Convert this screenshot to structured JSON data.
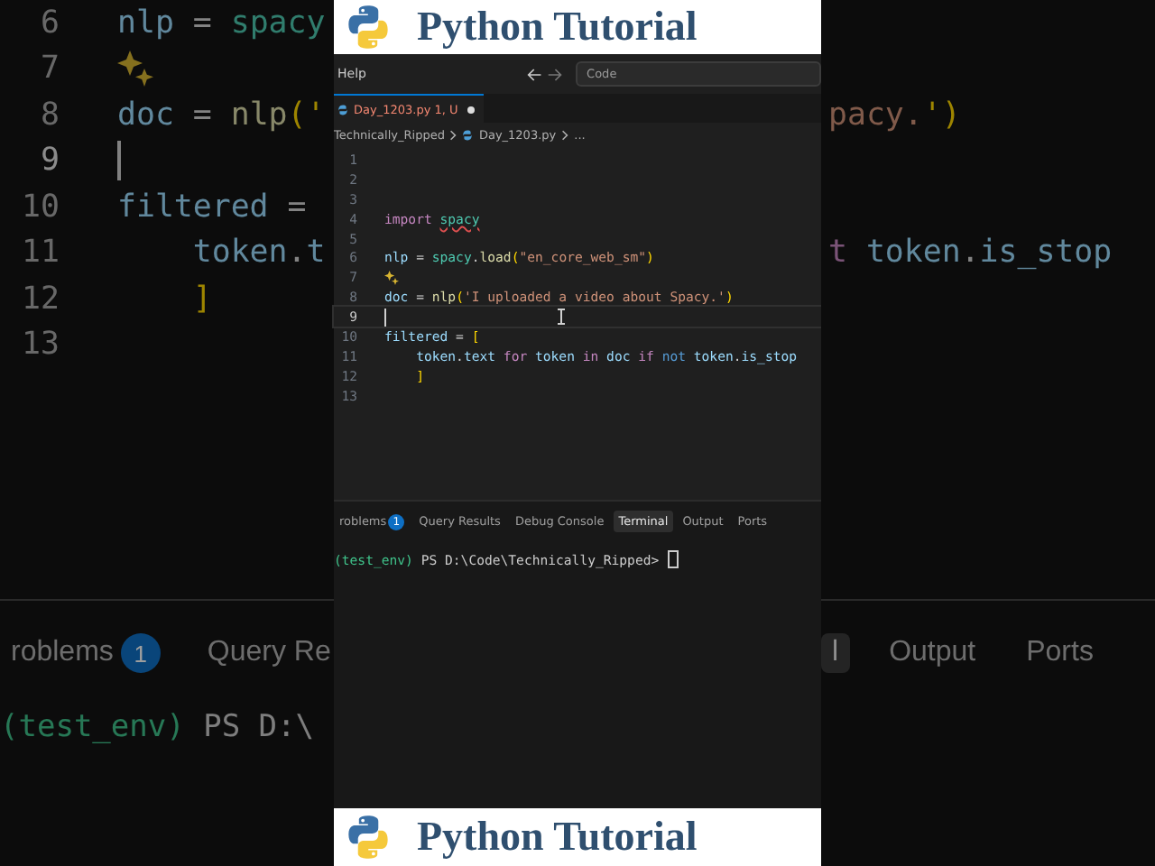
{
  "banner_top": {
    "title": "Python Tutorial"
  },
  "backdrop": {
    "left_rows": [
      {
        "number": "6",
        "current": false,
        "hint": false,
        "code": [
          {
            "text": "nlp",
            "kind": "var"
          },
          {
            "text": " = ",
            "kind": "op"
          },
          {
            "text": "spacy",
            "kind": "mod"
          }
        ]
      },
      {
        "number": "7",
        "current": false,
        "hint": true
      },
      {
        "number": "8",
        "current": false,
        "hint": false,
        "code": [
          {
            "text": "doc",
            "kind": "var"
          },
          {
            "text": " = ",
            "kind": "op"
          },
          {
            "text": "nlp",
            "kind": "fn"
          },
          {
            "text": "('",
            "kind": "br"
          }
        ]
      },
      {
        "number": "9",
        "current": true,
        "hint": false
      },
      {
        "number": "10",
        "current": false,
        "hint": false,
        "code": [
          {
            "text": "filtered",
            "kind": "var"
          },
          {
            "text": " = ",
            "kind": "op"
          }
        ]
      },
      {
        "number": "11",
        "current": false,
        "hint": false,
        "code": [
          {
            "text": "    token",
            "kind": "var"
          },
          {
            "text": ".",
            "kind": "op"
          },
          {
            "text": "t",
            "kind": "var"
          }
        ]
      },
      {
        "number": "12",
        "current": false,
        "hint": false,
        "code": [
          {
            "text": "    ]",
            "kind": "br"
          }
        ]
      },
      {
        "number": "13",
        "current": false,
        "hint": false
      }
    ],
    "right_rows": [
      {},
      {},
      {
        "code": [
          {
            "text": "pacy.",
            "kind": "str"
          },
          {
            "text": "')",
            "kind": "br"
          }
        ]
      },
      {},
      {},
      {
        "code": [
          {
            "text": "t ",
            "kind": "kw"
          },
          {
            "text": "token",
            "kind": "var"
          },
          {
            "text": ".",
            "kind": "op"
          },
          {
            "text": "is_stop",
            "kind": "var"
          }
        ]
      },
      {},
      {}
    ],
    "left_tabs": [
      {
        "label": "roblems",
        "badge": "1",
        "selected": false
      },
      {
        "label": "Query Re",
        "selected": false
      }
    ],
    "right_tabs": [
      {
        "label": "l",
        "selected": true
      },
      {
        "label": "Output",
        "selected": false
      },
      {
        "label": "Ports",
        "selected": false
      }
    ],
    "left_terminal": [
      {
        "text": "(test_env)",
        "kind": "env"
      },
      {
        "text": " PS D:\\",
        "kind": "plain"
      }
    ]
  },
  "editor": {
    "menu": "Help",
    "search": {
      "placeholder": "Code"
    },
    "tab": {
      "label": "Day_1203.py",
      "status": "1, U",
      "modified": true
    },
    "breadcrumb": [
      "Technically_Ripped",
      "Day_1203.py",
      "..."
    ],
    "lines": [
      {
        "number": "1",
        "current": false,
        "hint": false
      },
      {
        "number": "2",
        "current": false,
        "hint": false
      },
      {
        "number": "3",
        "current": false,
        "hint": false
      },
      {
        "number": "4",
        "current": false,
        "hint": false,
        "code": [
          {
            "text": "import ",
            "kind": "kw"
          },
          {
            "text": "spacy",
            "kind": "mod",
            "warning": true
          }
        ]
      },
      {
        "number": "5",
        "current": false,
        "hint": false
      },
      {
        "number": "6",
        "current": false,
        "hint": false,
        "code": [
          {
            "text": "nlp",
            "kind": "var"
          },
          {
            "text": " = ",
            "kind": "op"
          },
          {
            "text": "spacy",
            "kind": "mod"
          },
          {
            "text": ".",
            "kind": "op"
          },
          {
            "text": "load",
            "kind": "fn"
          },
          {
            "text": "(",
            "kind": "br"
          },
          {
            "text": "\"en_core_web_sm\"",
            "kind": "str"
          },
          {
            "text": ")",
            "kind": "br"
          }
        ]
      },
      {
        "number": "7",
        "current": false,
        "hint": true
      },
      {
        "number": "8",
        "current": false,
        "hint": false,
        "code": [
          {
            "text": "doc",
            "kind": "var"
          },
          {
            "text": " = ",
            "kind": "op"
          },
          {
            "text": "nlp",
            "kind": "fn"
          },
          {
            "text": "(",
            "kind": "br"
          },
          {
            "text": "'I uploaded a video about Spacy.'",
            "kind": "str"
          },
          {
            "text": ")",
            "kind": "br"
          }
        ]
      },
      {
        "number": "9",
        "current": true,
        "hint": false
      },
      {
        "number": "10",
        "current": false,
        "hint": false,
        "code": [
          {
            "text": "filtered",
            "kind": "var"
          },
          {
            "text": " = ",
            "kind": "op"
          },
          {
            "text": "[",
            "kind": "br"
          }
        ]
      },
      {
        "number": "11",
        "current": false,
        "hint": false,
        "code": [
          {
            "text": "    token",
            "kind": "var"
          },
          {
            "text": ".",
            "kind": "op"
          },
          {
            "text": "text",
            "kind": "var"
          },
          {
            "text": " for ",
            "kind": "kw"
          },
          {
            "text": "token",
            "kind": "var"
          },
          {
            "text": " in ",
            "kind": "kw"
          },
          {
            "text": "doc",
            "kind": "var"
          },
          {
            "text": " if ",
            "kind": "kw"
          },
          {
            "text": "not",
            "kind": "not"
          },
          {
            "text": " token",
            "kind": "var"
          },
          {
            "text": ".",
            "kind": "op"
          },
          {
            "text": "is_stop",
            "kind": "var"
          }
        ]
      },
      {
        "number": "12",
        "current": false,
        "hint": false,
        "code": [
          {
            "text": "    ]",
            "kind": "br"
          }
        ]
      },
      {
        "number": "13",
        "current": false,
        "hint": false
      }
    ]
  },
  "panel": {
    "tabs": [
      {
        "label": "roblems",
        "badge": "1",
        "selected": false
      },
      {
        "label": "Query Results",
        "selected": false
      },
      {
        "label": "Debug Console",
        "selected": false
      },
      {
        "label": "Terminal",
        "selected": true
      },
      {
        "label": "Output",
        "selected": false
      },
      {
        "label": "Ports",
        "selected": false
      }
    ],
    "terminal": [
      {
        "text": "(test_env)",
        "kind": "env"
      },
      {
        "text": " PS D:\\Code\\Technically_Ripped> ",
        "kind": "plain"
      }
    ]
  },
  "banner_bottom": {
    "title": "Python Tutorial"
  }
}
